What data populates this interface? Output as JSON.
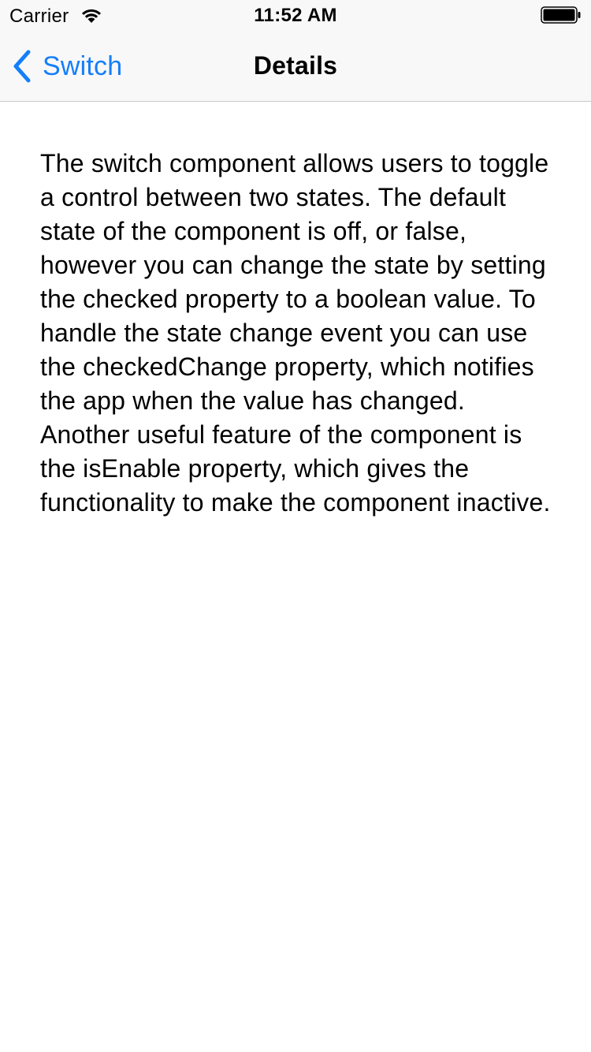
{
  "status_bar": {
    "carrier": "Carrier",
    "time": "11:52 AM",
    "icons": [
      "wifi-icon",
      "battery-icon"
    ]
  },
  "nav_bar": {
    "back_label": "Switch",
    "back_icon": "chevron-left-icon",
    "title": "Details"
  },
  "content": {
    "description": "The switch component allows users to toggle a control between two states. The default state of the component is off, or false, however you can change the state by setting the checked property to a boolean value. To handle the state change event you can use the checkedChange property, which notifies the app when the value has changed. Another useful feature of the component is the isEnable property, which gives the functionality to make the component inactive."
  },
  "colors": {
    "accent": "#147efb",
    "nav_background": "#f8f8f8",
    "separator": "#c8c7cc",
    "text": "#000000",
    "background": "#ffffff"
  }
}
